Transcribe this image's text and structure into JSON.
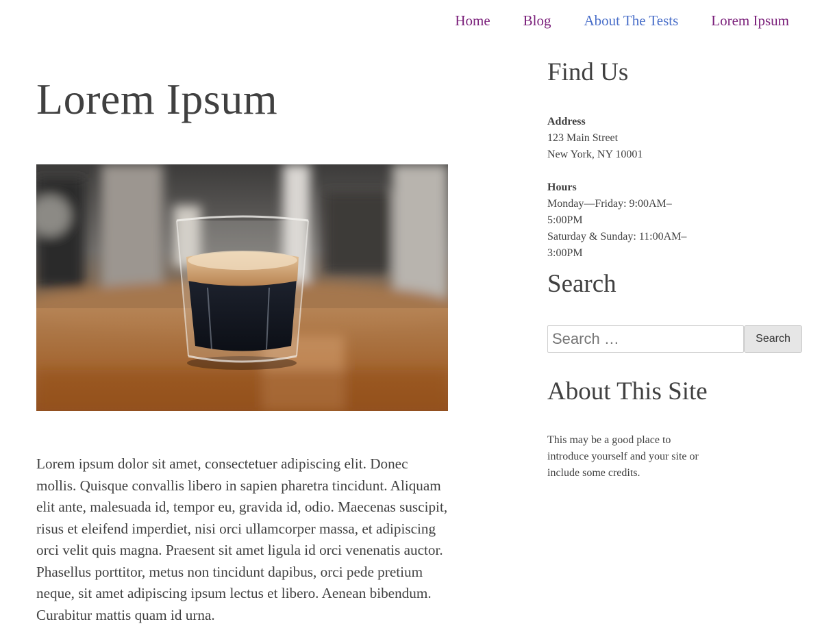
{
  "nav": {
    "items": [
      {
        "label": "Home",
        "active": false
      },
      {
        "label": "Blog",
        "active": false
      },
      {
        "label": "About The Tests",
        "active": true
      },
      {
        "label": "Lorem Ipsum",
        "active": false
      }
    ],
    "colors": {
      "link": "#7a1f7a",
      "active": "#4a6fc9"
    }
  },
  "main": {
    "title": "Lorem Ipsum",
    "image_icon": "espresso-glass-photo",
    "body": "Lorem ipsum dolor sit amet, consectetuer adipiscing elit. Donec mollis. Quisque convallis libero in sapien pharetra tincidunt. Aliquam elit ante, malesuada id, tempor eu, gravida id, odio. Maecenas suscipit, risus et eleifend imperdiet, nisi orci ullamcorper massa, et adipiscing orci velit quis magna. Praesent sit amet ligula id orci venenatis auctor. Phasellus porttitor, metus non tincidunt dapibus, orci pede pretium neque, sit amet adipiscing ipsum lectus et libero. Aenean bibendum. Curabitur mattis quam id urna."
  },
  "sidebar": {
    "find_us": {
      "title": "Find Us",
      "address_label": "Address",
      "address_line1": "123 Main Street",
      "address_line2": "New York, NY 10001",
      "hours_label": "Hours",
      "hours_line1": "Monday—Friday: 9:00AM–5:00PM",
      "hours_line2": "Saturday & Sunday: 11:00AM–3:00PM"
    },
    "search": {
      "title": "Search",
      "placeholder": "Search …",
      "value": "",
      "button_label": "Search"
    },
    "about": {
      "title": "About This Site",
      "text": "This may be a good place to introduce yourself and your site or include some credits."
    }
  }
}
